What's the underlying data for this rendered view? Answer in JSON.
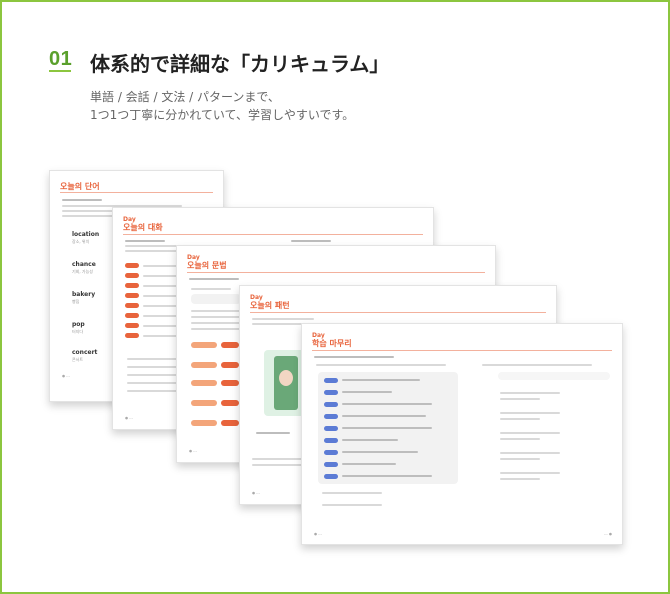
{
  "header": {
    "number": "01",
    "title": "体系的で詳細な「カリキュラム」",
    "subtitle_line1": "単語 / 会話 / 文法 / パターンまで、",
    "subtitle_line2": "1つ1つ丁寧に分かれていて、学習しやすいです。"
  },
  "pages": {
    "page1": {
      "title": "오늘의 단어"
    },
    "page2": {
      "title": "오늘의 대화"
    },
    "page3": {
      "title": "오늘의 문법"
    },
    "page4": {
      "title": "오늘의 패턴"
    },
    "page5": {
      "title": "학습 마무리"
    }
  },
  "colors": {
    "accent_green": "#8cc63f",
    "accent_orange": "#e8643c",
    "pill_blue": "#5b7bd5"
  }
}
